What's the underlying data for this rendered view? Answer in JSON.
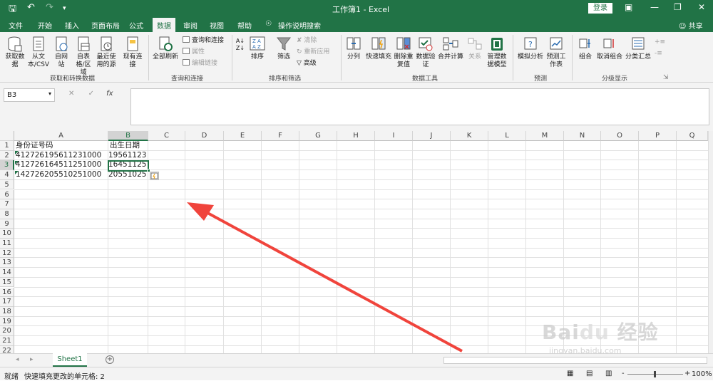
{
  "title_bar": {
    "title": "工作簿1 - Excel",
    "login_label": "登录"
  },
  "tabs": [
    {
      "label": "文件",
      "active": false
    },
    {
      "label": "开始",
      "active": false
    },
    {
      "label": "插入",
      "active": false
    },
    {
      "label": "页面布局",
      "active": false
    },
    {
      "label": "公式",
      "active": false
    },
    {
      "label": "数据",
      "active": true
    },
    {
      "label": "审阅",
      "active": false
    },
    {
      "label": "视图",
      "active": false
    },
    {
      "label": "帮助",
      "active": false
    },
    {
      "label": "操作说明搜索",
      "active": false
    }
  ],
  "share_label": "共享",
  "ribbon": {
    "get_transform": {
      "buttons": [
        "获取数据",
        "从文本/CSV",
        "自网站",
        "自表格/区域",
        "最近使用的源",
        "现有连接"
      ],
      "group_label": "获取和转换数据"
    },
    "queries": {
      "refresh_all": "全部刷新",
      "queries_connections": "查询和连接",
      "properties": "属性",
      "edit_links": "编辑链接",
      "group_label": "查询和连接"
    },
    "sort_filter": {
      "sort": "排序",
      "filter": "筛选",
      "clear": "清除",
      "reapply": "重新应用",
      "advanced": "高级",
      "group_label": "排序和筛选"
    },
    "data_tools": {
      "text_to_columns": "分列",
      "flash_fill": "快速填充",
      "remove_duplicates": "删除重复值",
      "data_validation": "数据验证",
      "consolidate": "合并计算",
      "relationships": "关系",
      "manage_data_model": "管理数据模型",
      "group_label": "数据工具"
    },
    "forecast": {
      "what_if": "模拟分析",
      "forecast_sheet": "预测工作表",
      "group_label": "预测"
    },
    "outline": {
      "group": "组合",
      "ungroup": "取消组合",
      "subtotal": "分类汇总",
      "group_label": "分级显示"
    }
  },
  "name_box": "B3",
  "fx_label": "fx",
  "columns": [
    "A",
    "B",
    "C",
    "D",
    "E",
    "F",
    "G",
    "H",
    "I",
    "J",
    "K",
    "L",
    "M",
    "N",
    "O",
    "P",
    "Q"
  ],
  "rows": [
    "1",
    "2",
    "3",
    "4",
    "5",
    "6",
    "7",
    "8",
    "9",
    "10",
    "11",
    "12",
    "13",
    "14",
    "15",
    "16",
    "17",
    "18",
    "19",
    "20",
    "21",
    "22"
  ],
  "cells": {
    "A1": "身份证号码",
    "B1": "出生日期",
    "A2": "412726195611231000",
    "B2": "19561123",
    "A3": "412726164511251000",
    "B3": "16451125",
    "A4": "142726205510251000",
    "B4": "20551025"
  },
  "sheet_tab": "Sheet1",
  "status": {
    "ready": "就绪",
    "message": "快速填充更改的单元格: 2",
    "zoom": "100%"
  },
  "colors": {
    "brand": "#217346",
    "arrow": "#f0443c"
  },
  "watermark": {
    "logo": "Baidu 经验",
    "url": "jingyan.baidu.com"
  }
}
